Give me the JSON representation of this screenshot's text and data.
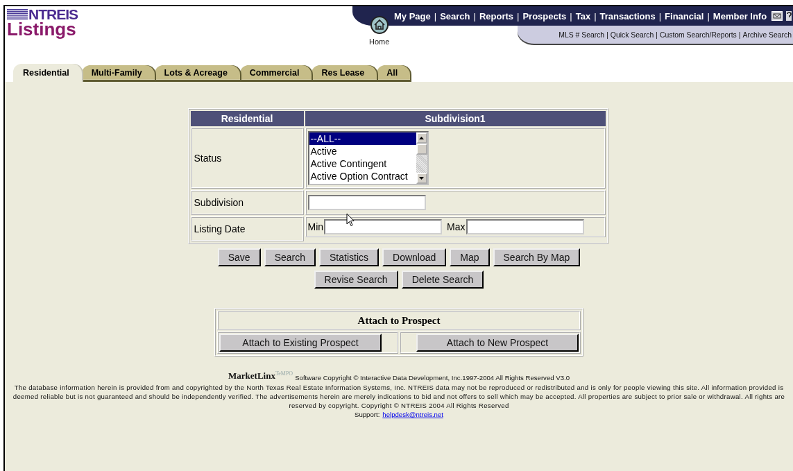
{
  "logo": {
    "line1": "NTREIS",
    "line2": "Listings"
  },
  "nav": {
    "separator": "|",
    "items": [
      "My Page",
      "Search",
      "Reports",
      "Prospects",
      "Tax",
      "Transactions",
      "Financial",
      "Member Info"
    ],
    "home": "Home",
    "sub_items": [
      "MLS # Search",
      "Quick Search",
      "Custom Search/Reports",
      "Archive Search"
    ]
  },
  "tabs": [
    {
      "label": "Residential",
      "selected": true
    },
    {
      "label": "Multi-Family",
      "selected": false
    },
    {
      "label": "Lots & Acreage",
      "selected": false
    },
    {
      "label": "Commercial",
      "selected": false
    },
    {
      "label": "Res Lease",
      "selected": false
    },
    {
      "label": "All",
      "selected": false
    }
  ],
  "form": {
    "headers": [
      "Residential",
      "Subdivision1"
    ],
    "status": {
      "label": "Status",
      "options": [
        {
          "label": "--ALL--",
          "selected": true
        },
        {
          "label": "Active",
          "selected": false
        },
        {
          "label": "Active Contingent",
          "selected": false
        },
        {
          "label": "Active Option Contract",
          "selected": false
        }
      ]
    },
    "subdivision": {
      "label": "Subdivision"
    },
    "listing_date": {
      "label": "Listing Date",
      "min": "Min",
      "max": "Max"
    }
  },
  "buttons": [
    [
      "Save",
      "Search",
      "Statistics",
      "Download",
      "Map",
      "Search By Map"
    ],
    [
      "Revise Search",
      "Delete  Search"
    ]
  ],
  "attach": {
    "title": "Attach to Prospect",
    "buttons": [
      "Attach to Existing Prospect",
      "Attach to New Prospect"
    ]
  },
  "footer": {
    "brand": "MarketLinx",
    "brand_sub": "TeMPO",
    "copyright": "Software Copyright © Interactive Data Development, Inc.1997-2004 All Rights Reserved V3.0",
    "disclaimer": "The database information herein is provided from and copyrighted by the North Texas Real Estate Information Systems, Inc. NTREIS data may not be reproduced or redistributed and is only for people viewing this site. All information provided is deemed reliable but is not guaranteed and should be independently verified. The advertisements herein are merely indications to bid and not offers to sell which may be accepted. All properties are subject to prior sale or withdrawal. All rights are reserved by copyright. Copyright © NTREIS 2004 All Rights Reserved",
    "support_label": "Support:",
    "support_link": "helpdesk@ntreis.net"
  }
}
